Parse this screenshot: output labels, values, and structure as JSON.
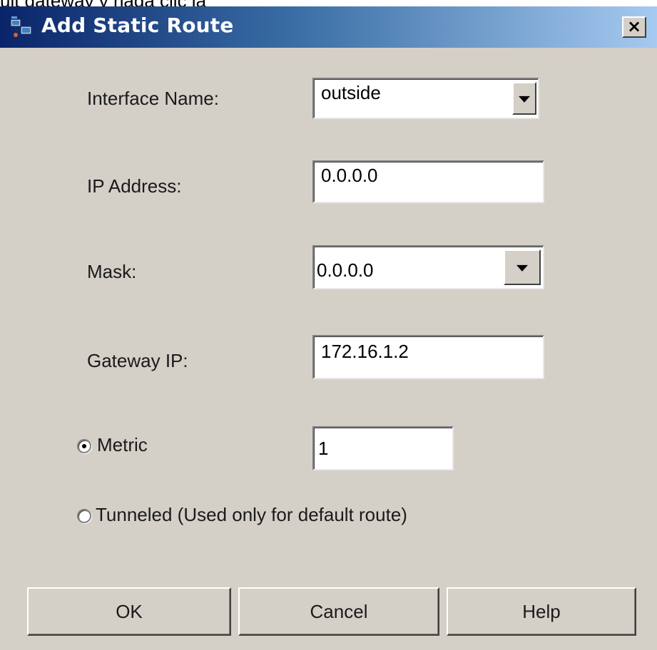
{
  "caption": "ult gateway y haga clic la",
  "dialog": {
    "title": "Add Static Route",
    "close_glyph": "×"
  },
  "form": {
    "interface_name": {
      "label": "Interface Name:",
      "value": "outside"
    },
    "ip_address": {
      "label": "IP Address:",
      "value": "0.0.0.0"
    },
    "mask": {
      "label": "Mask:",
      "value": "0.0.0.0"
    },
    "gateway_ip": {
      "label": "Gateway IP:",
      "value": "172.16.1.2"
    },
    "metric": {
      "label": "Metric",
      "value": "1",
      "selected": true
    },
    "tunneled": {
      "label": "Tunneled  (Used only for default route)",
      "selected": false
    }
  },
  "buttons": {
    "ok": "OK",
    "cancel": "Cancel",
    "help": "Help"
  },
  "colors": {
    "dialog_background": "#d4d0c8",
    "title_gradient_start": "#0a246a",
    "title_gradient_end": "#a6caf0",
    "title_text": "#ffffff"
  }
}
